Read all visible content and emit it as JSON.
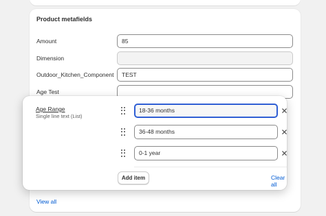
{
  "metafields_card": {
    "title": "Product metafields",
    "fields": [
      {
        "label": "Amount",
        "value": "85"
      },
      {
        "label": "Dimension",
        "value": ""
      },
      {
        "label": "Outdoor_Kitchen_Component",
        "value": "TEST"
      },
      {
        "label": "Age Test",
        "value": ""
      }
    ],
    "view_all": "View all"
  },
  "age_range_popover": {
    "label": "Age Range",
    "sublabel": "Single line text (List)",
    "items": [
      {
        "value": "18-36 months",
        "focused": true
      },
      {
        "value": "36-48 months",
        "focused": false
      },
      {
        "value": "0-1 year",
        "focused": false
      }
    ],
    "add_item": "Add item",
    "clear_all": "Clear all"
  },
  "colors": {
    "link": "#005bd3",
    "focus_ring": "#2e5ed4"
  },
  "icons": {
    "drag": "drag-handle-icon",
    "remove": "close-icon"
  }
}
